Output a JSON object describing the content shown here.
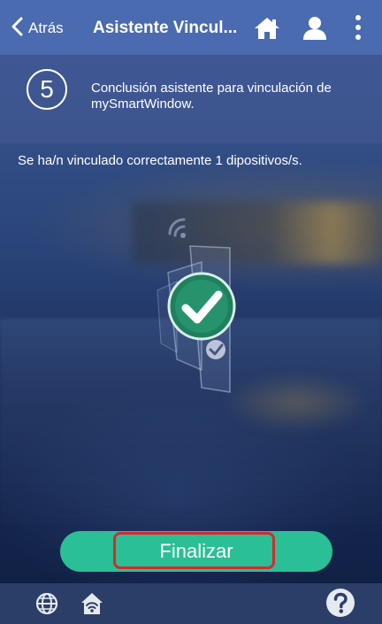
{
  "header": {
    "back_label": "Atrás",
    "title": "Asistente Vincul...",
    "icons": [
      "home-icon",
      "user-icon",
      "more-vertical-icon"
    ]
  },
  "step": {
    "number": "5",
    "description": "Conclusión asistente para vinculación de mySmartWindow."
  },
  "message": "Se ha/n vinculado correctamente  1 dipositivos/s.",
  "actions": {
    "finish_label": "Finalizar"
  },
  "footer": {
    "icons": [
      "globe-icon",
      "home-wifi-icon",
      "help-icon"
    ]
  },
  "colors": {
    "header": "#4b6bb0",
    "accent": "#2abf95",
    "highlight": "#d8292f",
    "footer": "#2b3e68"
  }
}
